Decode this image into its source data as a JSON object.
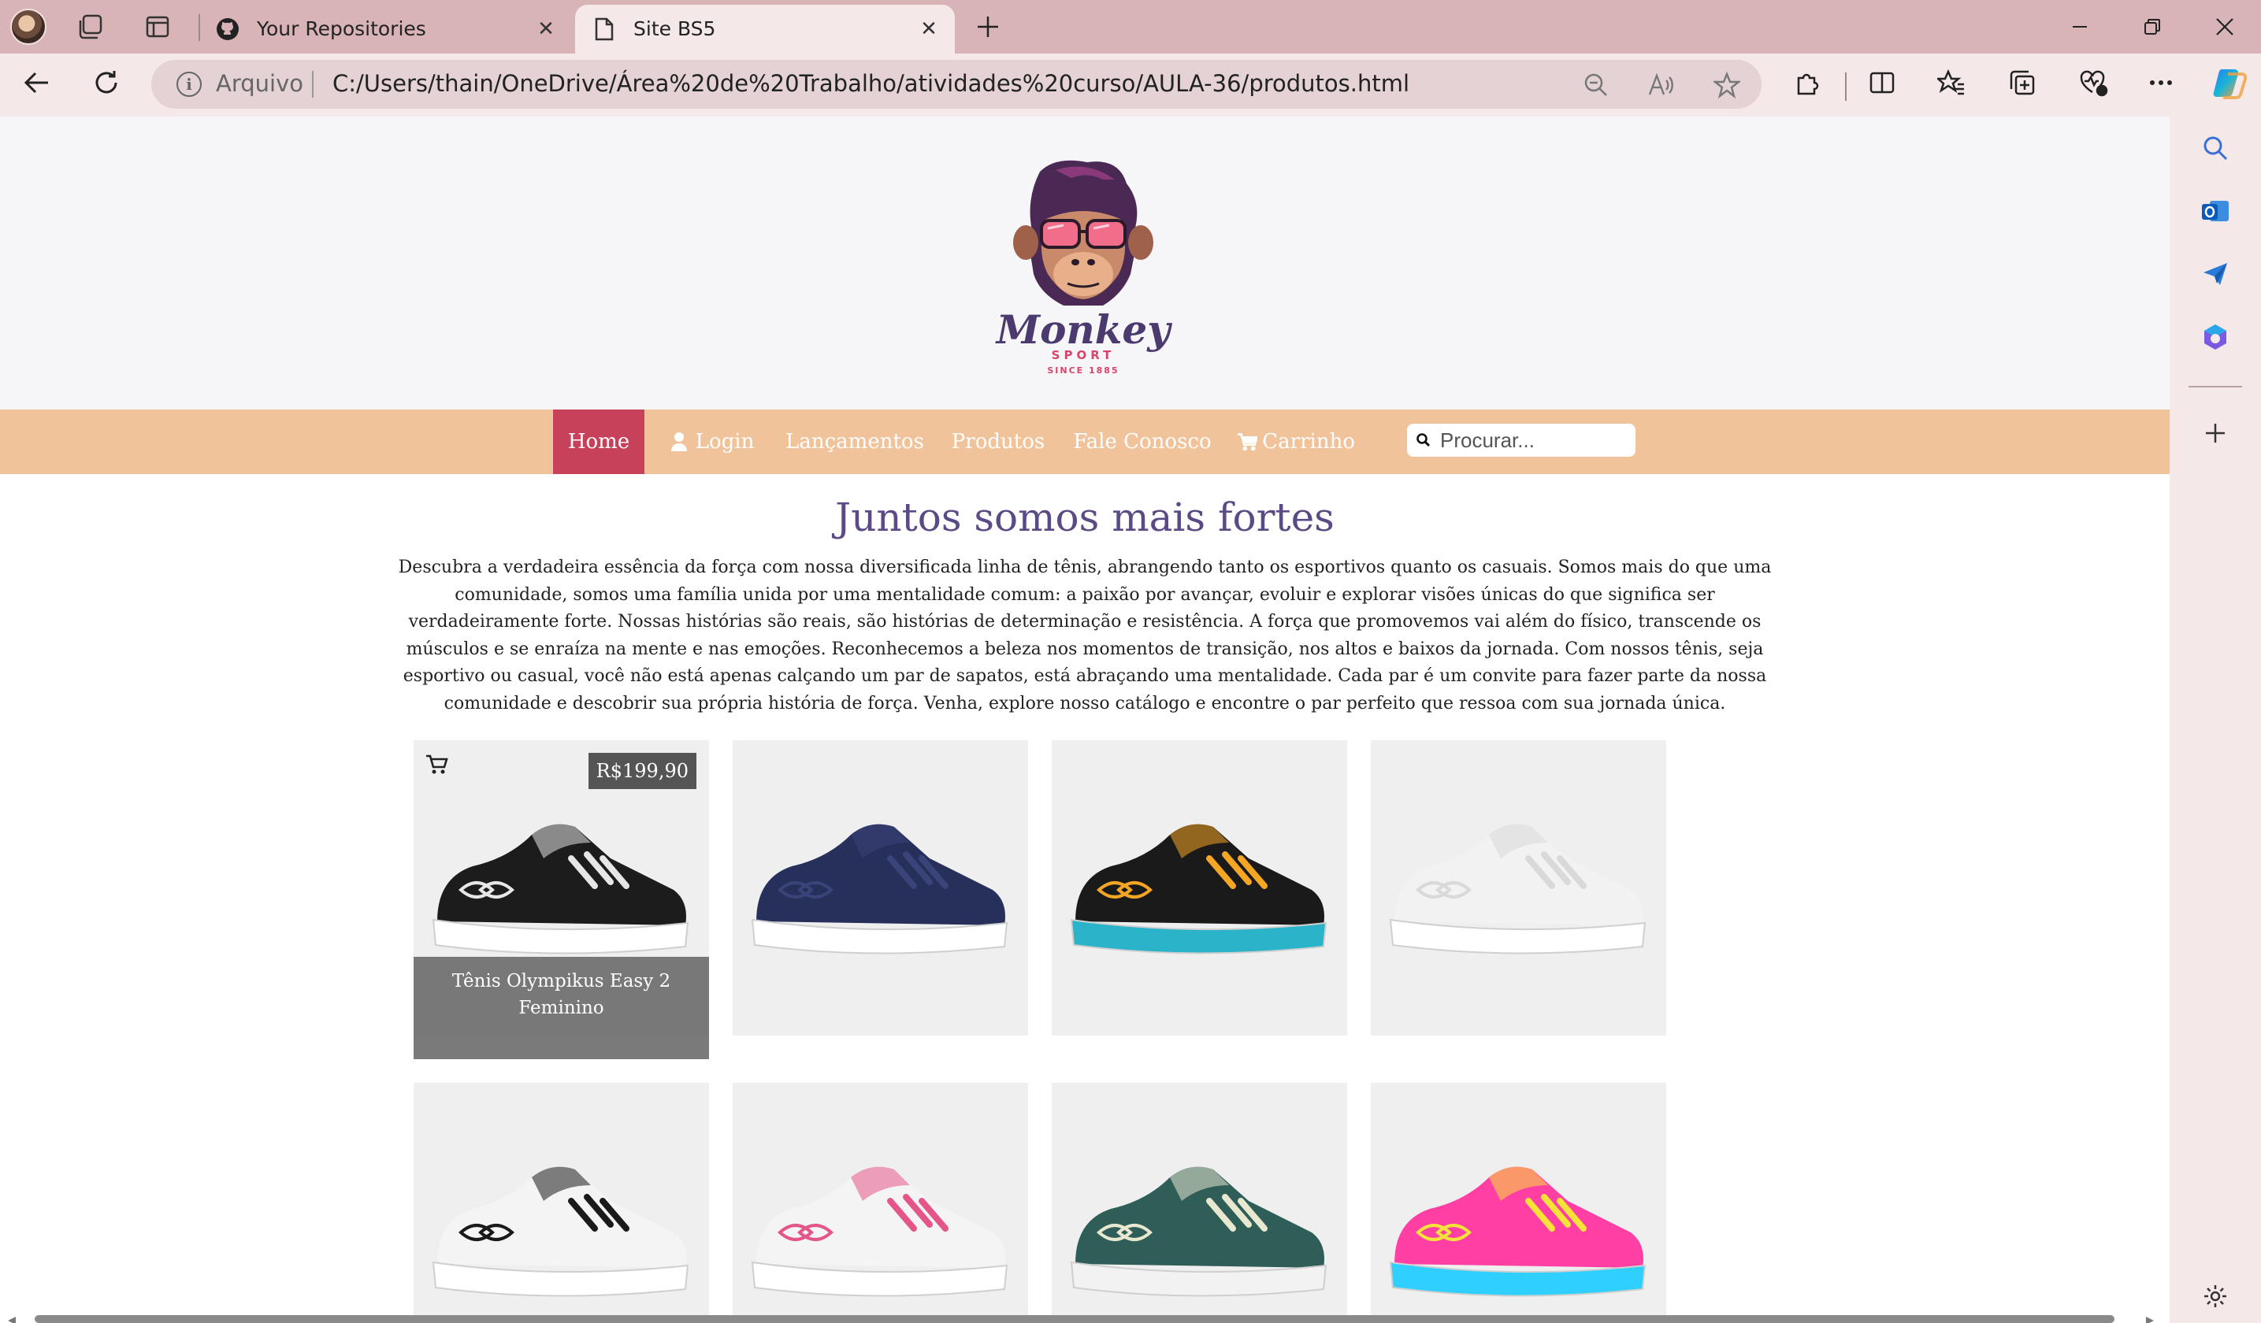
{
  "browser": {
    "tabs": [
      {
        "title": "Your Repositories",
        "icon": "github-icon",
        "active": false
      },
      {
        "title": "Site BS5",
        "icon": "page-icon",
        "active": true
      }
    ],
    "address": {
      "security_label": "Arquivo",
      "url": "C:/Users/thain/OneDrive/Área%20de%20Trabalho/atividades%20curso/AULA-36/produtos.html"
    }
  },
  "site": {
    "logo": {
      "name": "Monkey",
      "sub": "SPORT",
      "since": "SINCE 1885"
    },
    "nav": [
      {
        "label": "Home",
        "active": true
      },
      {
        "label": "Login",
        "icon": "user-icon"
      },
      {
        "label": "Lançamentos"
      },
      {
        "label": "Produtos"
      },
      {
        "label": "Fale Conosco"
      },
      {
        "label": "Carrinho",
        "icon": "cart-icon"
      }
    ],
    "search": {
      "placeholder": "Procurar..."
    },
    "title": "Juntos somos mais fortes",
    "intro": "Descubra a verdadeira essência da força com nossa diversificada linha de tênis, abrangendo tanto os esportivos quanto os casuais. Somos mais do que uma comunidade, somos uma família unida por uma mentalidade comum: a paixão por avançar, evoluir e explorar visões únicas do que significa ser verdadeiramente forte. Nossas histórias são reais, são histórias de determinação e resistência. A força que promovemos vai além do físico, transcende os músculos e se enraíza na mente e nas emoções. Reconhecemos a beleza nos momentos de transição, nos altos e baixos da jornada. Com nossos tênis, seja esportivo ou casual, você não está apenas calçando um par de sapatos, está abraçando uma mentalidade. Cada par é um convite para fazer parte da nossa comunidade e descobrir sua própria história de força. Venha, explore nosso catálogo e encontre o par perfeito que ressoa com sua jornada única.",
    "products": [
      {
        "name": "Tênis Olympikus Easy 2 Feminino",
        "price": "R$199,90",
        "hovered": true,
        "colors": {
          "body": "#1c1c1c",
          "sole": "#ffffff",
          "accent": "#e6e6e6"
        }
      },
      {
        "colors": {
          "body": "#26305a",
          "sole": "#ffffff",
          "accent": "#3a4478"
        }
      },
      {
        "colors": {
          "body": "#1a1a1a",
          "sole": "#2bb3c9",
          "accent": "#f5a623"
        }
      },
      {
        "colors": {
          "body": "#f2f2f2",
          "sole": "#ffffff",
          "accent": "#d9d9d9"
        }
      },
      {
        "colors": {
          "body": "#f4f4f4",
          "sole": "#ffffff",
          "accent": "#1a1a1a"
        }
      },
      {
        "colors": {
          "body": "#f4f4f4",
          "sole": "#ffffff",
          "accent": "#e4568a"
        }
      },
      {
        "colors": {
          "body": "#2f5d57",
          "sole": "#f2f2f2",
          "accent": "#e8e8d0"
        }
      },
      {
        "colors": {
          "body": "#ff3fa4",
          "sole": "#2fd0ff",
          "accent": "#f7e23a"
        }
      }
    ]
  }
}
